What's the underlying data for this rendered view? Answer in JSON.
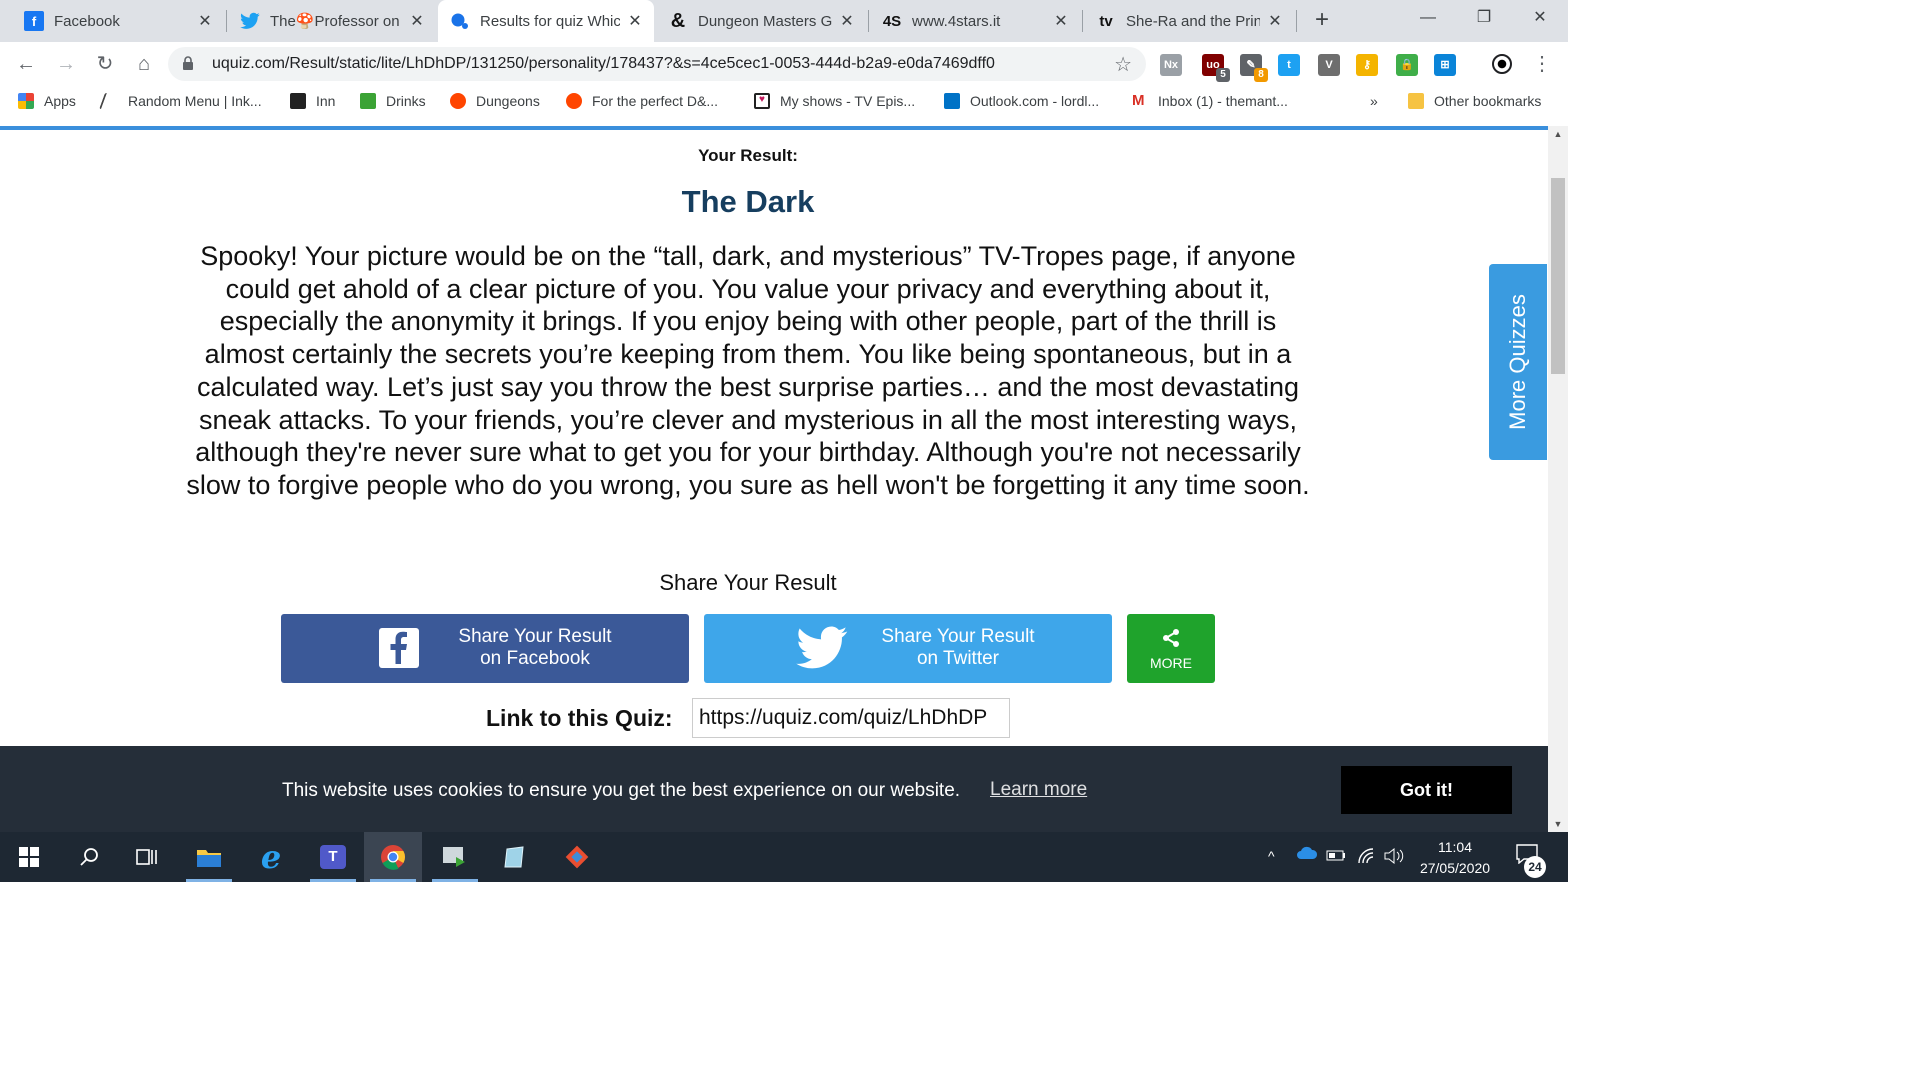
{
  "browser": {
    "tabs": [
      {
        "title": "Facebook",
        "icon": "facebook-icon",
        "active": false
      },
      {
        "title": "The🍄Professor on Twitter",
        "icon": "twitter-icon",
        "active": false
      },
      {
        "title": "Results for quiz Which Element",
        "icon": "uquiz-icon",
        "active": true
      },
      {
        "title": "Dungeon Masters Guild",
        "icon": "dnd-ampersand-icon",
        "active": false
      },
      {
        "title": "www.4stars.it",
        "icon": "4stars-icon",
        "active": false
      },
      {
        "title": "She-Ra and the Princesses of Power",
        "icon": "tv-icon",
        "active": false
      }
    ],
    "new_tab": "+",
    "address": "uquiz.com/Result/static/lite/LhDhDP/131250/personality/178437?&s=4ce5cec1-0053-444d-b2a9-e0da7469dff0",
    "extensions": [
      {
        "name": "nx-extension-icon",
        "label": "Nx",
        "color": "#9aa0a6",
        "badge": ""
      },
      {
        "name": "ublock-origin-icon",
        "label": "uo",
        "color": "#800000",
        "badge": "5"
      },
      {
        "name": "pen-extension-icon",
        "label": "✎",
        "color": "#5f6368",
        "badge": "8"
      },
      {
        "name": "twitter-extension-icon",
        "label": "t",
        "color": "#1da1f2",
        "badge": ""
      },
      {
        "name": "v-extension-icon",
        "label": "V",
        "color": "#6e6e6e",
        "badge": ""
      },
      {
        "name": "key-extension-icon",
        "label": "⚷",
        "color": "#f4b400",
        "badge": ""
      },
      {
        "name": "lock-extension-icon",
        "label": "🔒",
        "color": "#3fae49",
        "badge": ""
      },
      {
        "name": "windows-extension-icon",
        "label": "⊞",
        "color": "#0a84d8",
        "badge": ""
      }
    ],
    "bookmarks": [
      {
        "label": "Apps",
        "icon": "apps-grid-icon",
        "color": "#d93025"
      },
      {
        "label": "Random Menu | Ink...",
        "icon": "quill-icon",
        "color": "#444444"
      },
      {
        "label": "Inn",
        "icon": "inn-icon",
        "color": "#222222"
      },
      {
        "label": "Drinks",
        "icon": "drinks-icon",
        "color": "#3ba335"
      },
      {
        "label": "Dungeons",
        "icon": "reddit-icon",
        "color": "#ff4500"
      },
      {
        "label": "For the perfect D&...",
        "icon": "reddit-icon",
        "color": "#ff4500"
      },
      {
        "label": "My shows - TV Epis...",
        "icon": "tv-heart-icon",
        "color": "#c2185b"
      },
      {
        "label": "Outlook.com - lordl...",
        "icon": "outlook-icon",
        "color": "#0072c6"
      },
      {
        "label": "Inbox (1) - themant...",
        "icon": "gmail-icon",
        "color": "#d93025"
      }
    ],
    "bookmarks_overflow": "»",
    "other_bookmarks": "Other bookmarks"
  },
  "page": {
    "result_label": "Your Result:",
    "result_title": "The Dark",
    "result_description": "Spooky! Your picture would be on the “tall, dark, and mysterious” TV-Tropes page, if anyone could get ahold of a clear picture of you. You value your privacy and everything about it, especially the anonymity it brings. If you enjoy being with other people, part of the thrill is almost certainly the secrets you’re keeping from them. You like being spontaneous, but in a calculated way. Let’s just say you throw the best surprise parties… and the most devastating sneak attacks. To your friends, you’re clever and mysterious in all the most interesting ways, although they're never sure what to get you for your birthday. Although you're not necessarily slow to forgive people who do you wrong, you sure as hell won't be forgetting it any time soon.",
    "share_heading": "Share Your Result",
    "share_facebook": {
      "line1": "Share Your Result",
      "line2": "on Facebook"
    },
    "share_twitter": {
      "line1": "Share Your Result",
      "line2": "on Twitter"
    },
    "share_more": "MORE",
    "link_label": "Link to this Quiz:",
    "link_value": "https://uquiz.com/quiz/LhDhDP",
    "more_quizzes": "More Quizzes",
    "colors": {
      "title": "#163e5f",
      "facebook": "#3b5998",
      "twitter": "#3ea6ea",
      "more": "#1fa32c",
      "side_tab": "#3a9be0"
    }
  },
  "cookie_banner": {
    "message": "This website uses cookies to ensure you get the best experience on our website.",
    "learn_more": "Learn more",
    "button": "Got it!"
  },
  "taskbar": {
    "apps": [
      "start-icon",
      "search-icon",
      "task-view-icon",
      "file-explorer-icon",
      "internet-explorer-icon",
      "teams-icon",
      "chrome-icon",
      "media-player-icon",
      "notepad-icon",
      "git-icon"
    ],
    "time": "11:04",
    "date": "27/05/2020",
    "notification_count": "24"
  }
}
